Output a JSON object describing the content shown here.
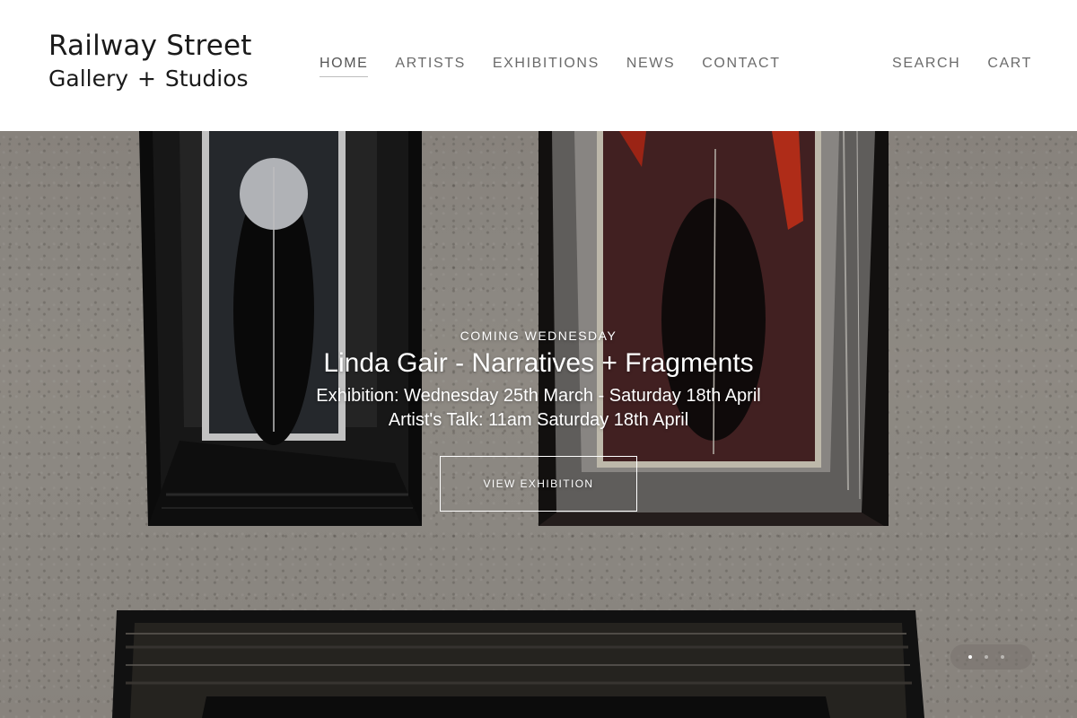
{
  "site": {
    "logo_line1": "Railway Street",
    "logo_line2": "Gallery + Studios"
  },
  "nav": {
    "items": [
      {
        "label": "HOME",
        "active": true
      },
      {
        "label": "ARTISTS"
      },
      {
        "label": "EXHIBITIONS"
      },
      {
        "label": "NEWS"
      },
      {
        "label": "CONTACT"
      }
    ]
  },
  "utility": {
    "search_label": "SEARCH",
    "cart_label": "CART"
  },
  "hero": {
    "kicker": "COMING WEDNESDAY",
    "title": "Linda Gair - Narratives + Fragments",
    "line1": "Exhibition: Wednesday 25th March - Saturday 18th April",
    "line2": "Artist's Talk: 11am Saturday 18th April",
    "cta_label": "VIEW EXHIBITION",
    "slide_count": 3,
    "active_slide": 1
  },
  "colors": {
    "header_bg": "#ffffff",
    "nav_text": "#6b6b6b",
    "hero_text": "#ffffff"
  }
}
